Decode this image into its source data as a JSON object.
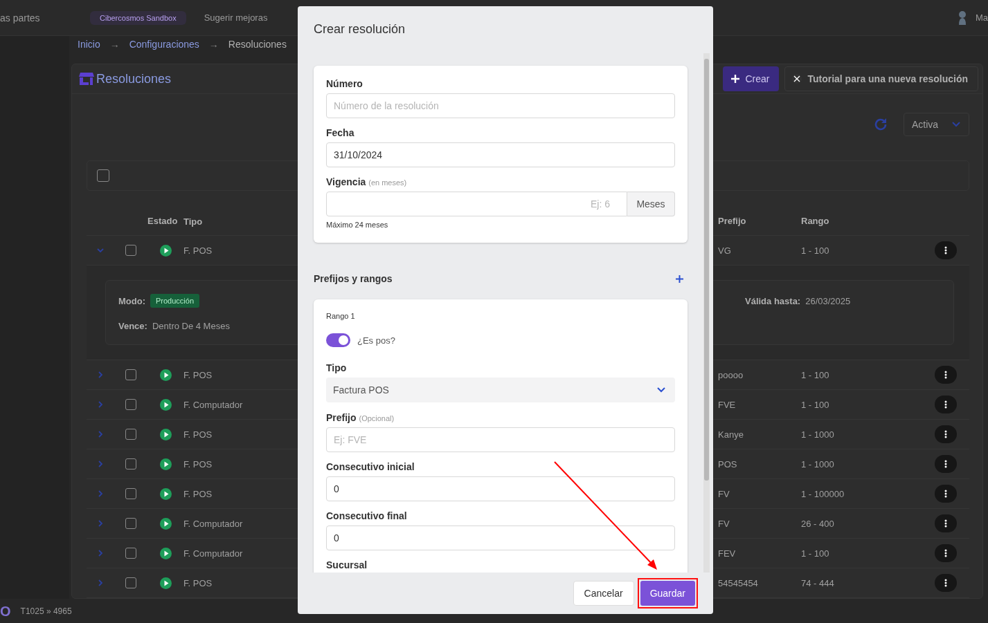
{
  "top_bar": {
    "left_text": "as partes",
    "workspace": "Cibercosmos Sandbox",
    "suggest": "Sugerir mejoras",
    "user_name": "Ma"
  },
  "breadcrumb": [
    {
      "label": "Inicio",
      "current": false
    },
    {
      "label": "→",
      "kind": "sep"
    },
    {
      "label": "Configuraciones",
      "current": false
    },
    {
      "label": "→",
      "kind": "sep"
    },
    {
      "label": "Resoluciones",
      "current": true
    }
  ],
  "page": {
    "title": "Resoluciones",
    "create_button": "Crear",
    "tutorial_button": "Tutorial para una nueva resolución",
    "filter": "Activa"
  },
  "table": {
    "select_all_checked": false,
    "columns": [
      "Estado",
      "Tipo",
      "Prefijo",
      "Rango"
    ],
    "rows": [
      {
        "expanded": true,
        "checked": false,
        "tipo": "F. POS",
        "prefijo": "VG",
        "rango": "1 - 100",
        "details": {
          "mode_label": "Modo:",
          "mode": "Producción",
          "due_label": "Vence:",
          "due": "Dentro De 4 Meses",
          "valid_label": "Válida hasta:",
          "valid": "26/03/2025"
        }
      },
      {
        "expanded": false,
        "checked": false,
        "tipo": "F. POS",
        "prefijo": "poooo",
        "rango": "1 - 100"
      },
      {
        "expanded": false,
        "checked": false,
        "tipo": "F. Computador",
        "prefijo": "FVE",
        "rango": "1 - 100"
      },
      {
        "expanded": false,
        "checked": false,
        "tipo": "F. POS",
        "prefijo": "Kanye",
        "rango": "1 - 1000"
      },
      {
        "expanded": false,
        "checked": false,
        "tipo": "F. POS",
        "prefijo": "POS",
        "rango": "1 - 1000"
      },
      {
        "expanded": false,
        "checked": false,
        "tipo": "F. POS",
        "prefijo": "FV",
        "rango": "1 - 100000"
      },
      {
        "expanded": false,
        "checked": false,
        "tipo": "F. Computador",
        "prefijo": "FV",
        "rango": "26 - 400"
      },
      {
        "expanded": false,
        "checked": false,
        "tipo": "F. Computador",
        "prefijo": "FEV",
        "rango": "1 - 100"
      },
      {
        "expanded": false,
        "checked": false,
        "tipo": "F. POS",
        "prefijo": "54545454",
        "rango": "74 - 444"
      }
    ]
  },
  "footer": {
    "logo": "O",
    "text": "T1025 » 4965"
  },
  "modal": {
    "title": "Crear resolución",
    "numero": {
      "label": "Número",
      "placeholder": "Número de la resolución"
    },
    "fecha": {
      "label": "Fecha",
      "value": "31/10/2024"
    },
    "vigencia": {
      "label": "Vigencia",
      "hint": "(en meses)",
      "placeholder": "Ej: 6",
      "addon": "Meses",
      "help": "Máximo 24 meses"
    },
    "section_title": "Prefijos y rangos",
    "range": {
      "title": "Rango 1",
      "is_pos": {
        "label": "¿Es pos?",
        "on": true
      },
      "tipo": {
        "label": "Tipo",
        "value": "Factura POS"
      },
      "prefijo": {
        "label": "Prefijo",
        "hint": "(Opcional)",
        "placeholder": "Ej: FVE"
      },
      "inicial": {
        "label": "Consecutivo inicial",
        "value": "0"
      },
      "final": {
        "label": "Consecutivo final",
        "value": "0"
      },
      "sucursal": {
        "label": "Sucursal"
      }
    },
    "cancel": "Cancelar",
    "save": "Guardar"
  }
}
